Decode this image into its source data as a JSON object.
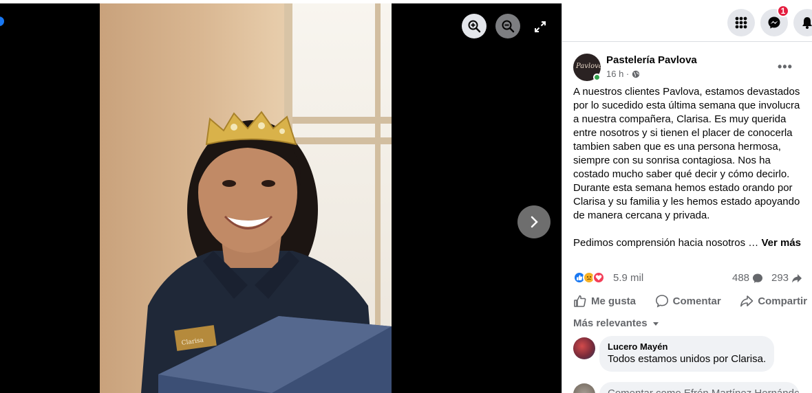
{
  "viewer": {
    "zoom_in_icon": "zoom-in-icon",
    "zoom_out_icon": "zoom-out-icon",
    "fullscreen_icon": "fullscreen-icon",
    "next_icon": "chevron-right-icon",
    "name_tag": "Clarisa"
  },
  "topbar": {
    "apps_icon": "grid-menu-icon",
    "messenger_icon": "messenger-icon",
    "notifications_icon": "bell-icon",
    "messenger_badge": "1"
  },
  "post": {
    "page_name": "Pastelería Pavlova",
    "time": "16 h ·",
    "privacy_icon": "globe-icon",
    "more": "•••",
    "paragraph1": "A nuestros clientes Pavlova, estamos devastados por lo sucedido esta última semana que involucra a nuestra compañera, Clarisa. Es muy querida entre nosotros y si tienen el placer de conocerla tambien saben que es una persona hermosa, siempre con su sonrisa contagiosa. Nos ha costado mucho saber qué decir y cómo decirlo. Durante esta semana hemos estado orando por Clarisa y su familia y les hemos estado apoyando de manera cercana y privada.",
    "paragraph2": "Pedimos comprensión hacia nosotros …",
    "see_more": "Ver más"
  },
  "stats": {
    "reactions": "5.9 mil",
    "comments": "488",
    "shares": "293"
  },
  "actions": {
    "like": "Me gusta",
    "comment": "Comentar",
    "share": "Compartir"
  },
  "comments": {
    "sort_label": "Más relevantes",
    "items": [
      {
        "author": "Lucero Mayén",
        "text": "Todos estamos unidos por Clarisa."
      }
    ],
    "partial_text": "Comentar como Efrén Martínez Hernández"
  },
  "colors": {
    "accent": "#1877f2",
    "badge": "#e41e3f",
    "online": "#31a24c",
    "secondary_text": "#65676b"
  }
}
